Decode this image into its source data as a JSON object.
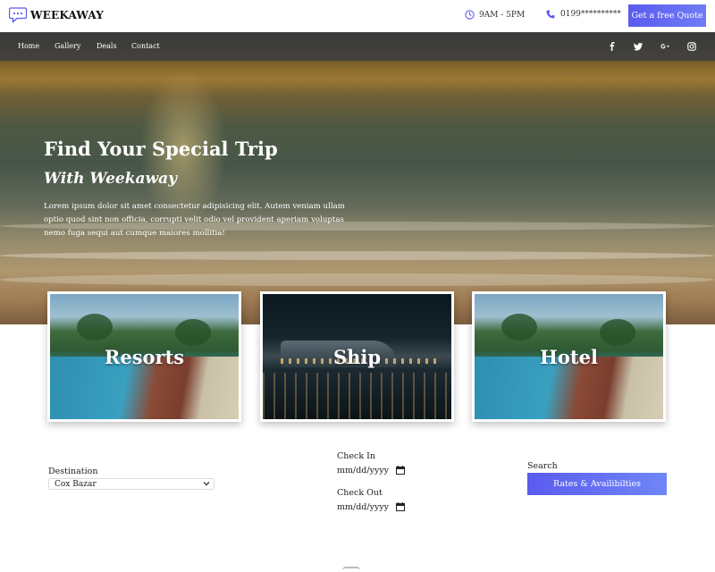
{
  "brand": {
    "name": "WEEKAWAY"
  },
  "topbar": {
    "hours": "9AM - 5PM",
    "phone": "0199**********",
    "quote_button": "Get a free Quote"
  },
  "nav": {
    "links": [
      "Home",
      "Gallery",
      "Deals",
      "Contact"
    ],
    "social_icons": [
      "facebook-icon",
      "twitter-icon",
      "google-plus-icon",
      "instagram-icon"
    ]
  },
  "hero": {
    "title": "Find Your Special Trip",
    "subtitle": "With Weekaway",
    "text": "Lorem ipsum dolor sit amet consectetur adipisicing elit. Autem veniam ullam optio quod sint non officia, corrupti velit odio vel provident aperiam voluptas nemo fuga sequi aut cumque maiores mollitia!"
  },
  "cards": [
    {
      "label": "Resorts"
    },
    {
      "label": "Ship"
    },
    {
      "label": "Hotel"
    }
  ],
  "booking": {
    "destination_label": "Destination",
    "destination_value": "Cox Bazar",
    "check_in_label": "Check In",
    "check_in_value": "mm/dd/yyyy",
    "check_out_label": "Check Out",
    "check_out_value": "mm/dd/yyyy",
    "search_label": "Search",
    "search_button": "Rates & Availibilties"
  },
  "colors": {
    "accent": "#5b5bee",
    "navbar": "#3c3e42"
  }
}
